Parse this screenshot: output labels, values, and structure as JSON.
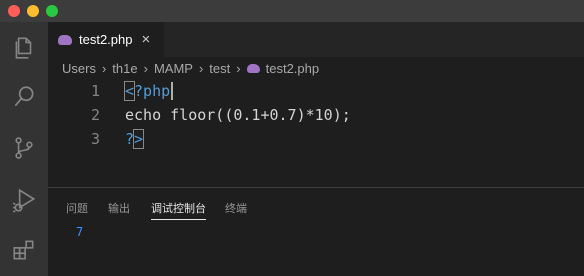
{
  "window": {
    "traffic_lights": [
      "close",
      "minimize",
      "maximize"
    ],
    "colors": {
      "close": "#ff5f57",
      "minimize": "#febc2e",
      "maximize": "#28c840"
    }
  },
  "activity_bar": {
    "items": [
      "explorer-icon",
      "search-icon",
      "source-control-icon",
      "run-debug-icon",
      "extensions-icon"
    ]
  },
  "tabs": [
    {
      "label": "test2.php",
      "icon": "php-elephant-icon",
      "close": "×",
      "active": true
    }
  ],
  "breadcrumb": {
    "items": [
      "Users",
      "th1e",
      "MAMP",
      "test",
      "test2.php"
    ],
    "separator": "›"
  },
  "editor": {
    "lines": [
      {
        "number": "1",
        "text": "<?php"
      },
      {
        "number": "2",
        "text": "echo floor((0.1+0.7)*10);"
      },
      {
        "number": "3",
        "text": "?>"
      }
    ],
    "colors": {
      "keyword": "#569cd6",
      "text": "#d4d4d4",
      "line_number": "#858585"
    }
  },
  "panel": {
    "tabs": [
      {
        "label": "问题",
        "active": false
      },
      {
        "label": "输出",
        "active": false
      },
      {
        "label": "调试控制台",
        "active": true
      },
      {
        "label": "终端",
        "active": false
      }
    ],
    "output": "7"
  }
}
